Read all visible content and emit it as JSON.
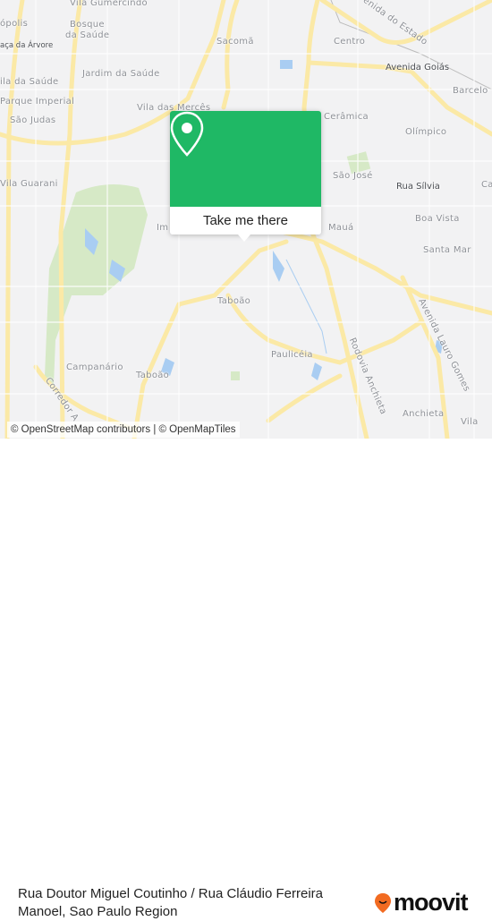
{
  "map": {
    "labels": {
      "vila_gumercindo": "Vila Gumercindo",
      "opolis": "ópolis",
      "bosque1": "Bosque",
      "bosque2": "da Saúde",
      "praca_arvore": "aça da Árvore",
      "sacoma": "Sacomã",
      "jardim_saude": "Jardim da Saúde",
      "vila_saude": "ila da Saúde",
      "parque_imperial": "Parque Imperial",
      "sao_judas": "São Judas",
      "vila_merces": "Vila das Mercês",
      "vila_guarani": "Vila Guarani",
      "centro": "Centro",
      "avenida_goias": "Avenida Goiás",
      "barcelona": "Barcelo",
      "ceramica": "Cerâmica",
      "olimpico": "Olímpico",
      "sao_jose": "São José",
      "rua_silvia": "Rua Sílvia",
      "boa_vista": "Boa Vista",
      "maua": "Mauá",
      "santa_maria": "Santa Mar",
      "taboao1": "Taboão",
      "pauliceia": "Paulicéia",
      "campanario": "Campanário",
      "taboao2": "Taboão",
      "anchieta": "Anchieta",
      "vila": "Vila",
      "ca": "Ca",
      "im": "Im",
      "rodovia_anchieta": "Rodovia Anchieta",
      "avenida_lauro_gomes": "Avenida Lauro Gomes",
      "corredor": "Corredor A",
      "avenida_estado": "enida do Estado"
    },
    "colors": {
      "road": "#fbe9a6",
      "park": "#d6e9c6",
      "water": "#a9cdf2",
      "background": "#f2f2f3"
    }
  },
  "popup": {
    "button_label": "Take me there",
    "icon": "map-pin-icon",
    "color": "#1fb865"
  },
  "attribution": "© OpenStreetMap contributors | © OpenMapTiles",
  "footer": {
    "place_title": "Rua Doutor Miguel Coutinho / Rua Cláudio Ferreira Manoel, Sao Paulo Region",
    "brand": "moovit",
    "brand_color": "#f26b21"
  }
}
